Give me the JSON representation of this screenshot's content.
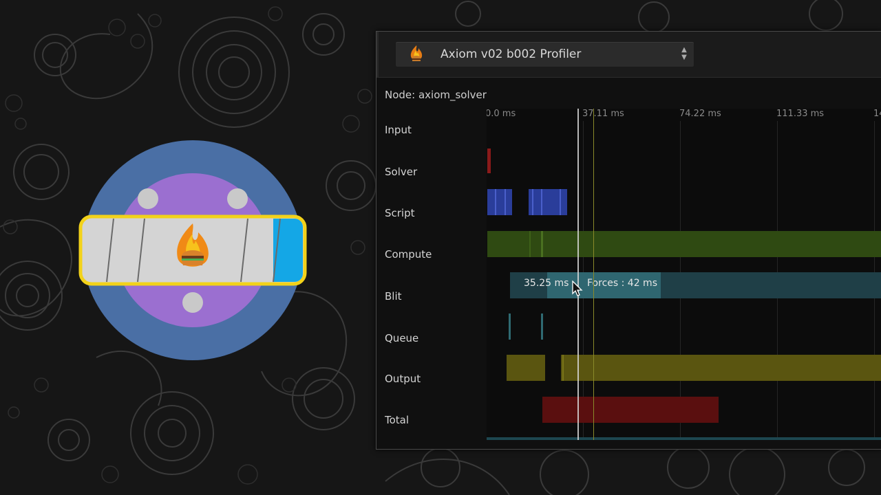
{
  "profiler": {
    "title": "Axiom v02 b002 Profiler",
    "node_label": "Node: axiom_solver",
    "ticks": [
      "0.0 ms",
      "37.11 ms",
      "74.22 ms",
      "111.33 ms",
      "14"
    ],
    "rows": [
      "Input",
      "Solver",
      "Script",
      "Compute",
      "Blit",
      "Queue",
      "Output",
      "Total"
    ],
    "compute_time_label": "35.25 ms",
    "compute_tooltip": "Forces : 42 ms"
  },
  "colors": {
    "input": "#8a1a1a",
    "solver": "#2a3d9a",
    "script": "#2f4a12",
    "compute": "#2c5560",
    "blit": "#2f6a72",
    "queue": "#5a5510",
    "output": "#5a0f0f",
    "total": "#1d4750",
    "logo_outer": "#4a6fa5",
    "logo_inner": "#9b6fd0",
    "logo_band_border": "#f2d21a",
    "logo_band_accent": "#14a7e6"
  },
  "icons": {
    "app_icon": "flaming-burger-icon",
    "selector_arrows": "updown-arrows-icon",
    "cursor": "mouse-pointer-icon"
  }
}
